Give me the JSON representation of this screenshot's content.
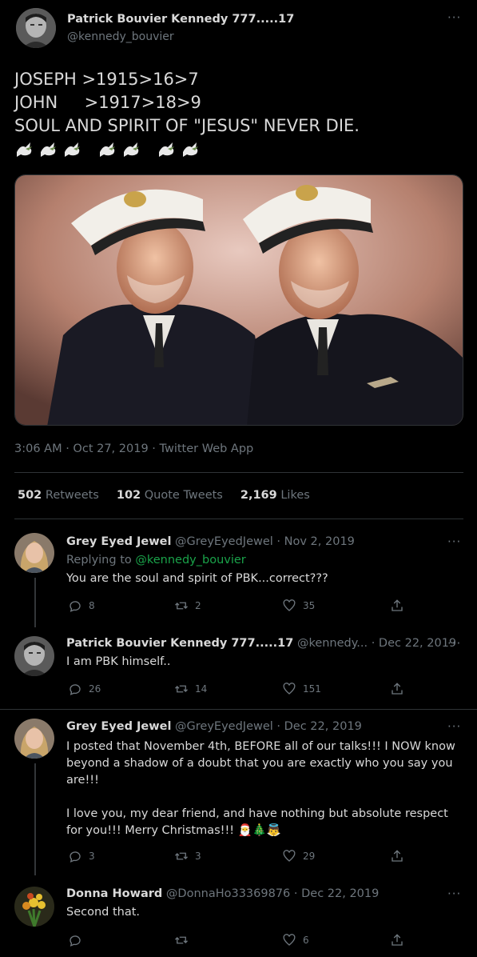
{
  "main_tweet": {
    "author_name": "Patrick Bouvier Kennedy 777.....17",
    "author_handle": "@kennedy_bouvier",
    "text_lines": [
      "JOSEPH >1915>16>7",
      "JOHN     >1917>18>9",
      "SOUL AND SPIRIT OF \"JESUS\" NEVER DIE."
    ],
    "dove_icons": [
      "dove-emoji",
      "dove-emoji",
      "dove-emoji",
      "dove-emoji",
      "dove-emoji",
      "dove-emoji",
      "dove-emoji"
    ],
    "timestamp": "3:06 AM · Oct 27, 2019 · Twitter Web App",
    "stats": {
      "retweets_count": "502",
      "retweets_label": "Retweets",
      "quotes_count": "102",
      "quotes_label": "Quote Tweets",
      "likes_count": "2,169",
      "likes_label": "Likes"
    }
  },
  "replies": [
    {
      "name": "Grey Eyed Jewel",
      "handle": "@GreyEyedJewel",
      "date": "· Nov 2, 2019",
      "replying_prefix": "Replying to ",
      "replying_to": "@kennedy_bouvier",
      "text": "You are the soul and spirit of PBK...correct???",
      "reply_count": "8",
      "retweet_count": "2",
      "like_count": "35"
    },
    {
      "name": "Patrick Bouvier Kennedy 777.....17",
      "handle": "@kennedy...",
      "date": "· Dec 22, 2019",
      "text": "I am PBK himself..",
      "reply_count": "26",
      "retweet_count": "14",
      "like_count": "151"
    },
    {
      "name": "Grey Eyed Jewel",
      "handle": "@GreyEyedJewel",
      "date": "· Dec 22, 2019",
      "text_p1": "I posted that November 4th, BEFORE all of our talks!!! I NOW know beyond a shadow of a doubt that you are exactly who you say you are!!!",
      "text_p2": "I love you, my dear friend, and have nothing but absolute respect for you!!! Merry Christmas!!!",
      "emojis": "🎅🎄👼",
      "reply_count": "3",
      "retweet_count": "3",
      "like_count": "29"
    },
    {
      "name": "Donna Howard",
      "handle": "@DonnaHo33369876",
      "date": "· Dec 22, 2019",
      "text": "Second that.",
      "reply_count": "",
      "retweet_count": "",
      "like_count": "6"
    }
  ],
  "more_label": "···",
  "colors": {
    "background": "#000000",
    "text": "#d9d9d9",
    "muted": "#6e767d",
    "link": "#1aa34a",
    "divider": "#2f3336"
  }
}
